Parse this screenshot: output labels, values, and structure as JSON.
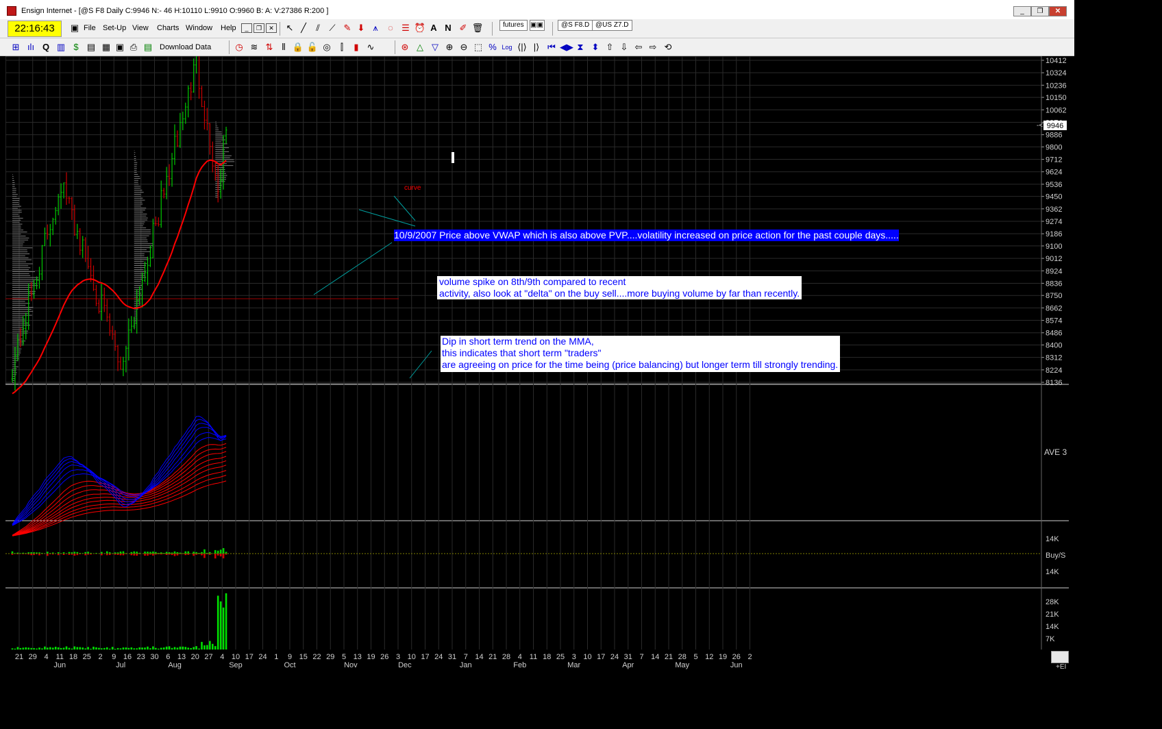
{
  "window": {
    "title": "Ensign Internet - [@S F8 Daily C:9946 N:- 46 H:10110 L:9910 O:9960 B: A: V:27386 R:200 ]",
    "clock": "22:16:43",
    "controls": {
      "minimize": "_",
      "restore": "❐",
      "close": "✕"
    }
  },
  "menu": [
    "File",
    "Set-Up",
    "View",
    "Charts",
    "Window",
    "Help"
  ],
  "tabs": {
    "futures": "futures",
    "chart1": "@S F8.D",
    "chart2": "@US Z7.D"
  },
  "toolbar": {
    "download_label": "Download Data"
  },
  "price_axis": {
    "ticks": [
      "10412",
      "10324",
      "10236",
      "10150",
      "10062",
      "9974",
      "9886",
      "9800",
      "9712",
      "9624",
      "9536",
      "9450",
      "9362",
      "9274",
      "9186",
      "9100",
      "9012",
      "8924",
      "8836",
      "8750",
      "8662",
      "8574",
      "8486",
      "8400",
      "8312",
      "8224",
      "8136"
    ],
    "current": "9946"
  },
  "mma_panel": {
    "label": "AVE 3"
  },
  "buysell_panel": {
    "ticks": [
      "14K",
      "Buy/S",
      "14K"
    ]
  },
  "volume_panel": {
    "ticks": [
      "28K",
      "21K",
      "14K",
      "7K"
    ]
  },
  "time_axis": {
    "days": [
      "21",
      "29",
      "4",
      "11",
      "18",
      "25",
      "2",
      "9",
      "16",
      "23",
      "30",
      "6",
      "13",
      "20",
      "27",
      "4",
      "10",
      "17",
      "24",
      "1",
      "9",
      "15",
      "22",
      "29",
      "5",
      "13",
      "19",
      "26",
      "3",
      "10",
      "17",
      "24",
      "31",
      "7",
      "14",
      "21",
      "28",
      "4",
      "11",
      "18",
      "25",
      "3",
      "10",
      "17",
      "24",
      "31",
      "7",
      "14",
      "21",
      "28",
      "5",
      "12",
      "19",
      "26",
      "2"
    ],
    "months": [
      "Jun",
      "Jul",
      "Aug",
      "Sep",
      "Oct",
      "Nov",
      "Dec",
      "Jan",
      "Feb",
      "Mar",
      "Apr",
      "May",
      "Jun"
    ],
    "corner": "+EI"
  },
  "annotations": {
    "curve_label": "curve",
    "note1": "10/9/2007 Price above VWAP which is also above PVP....volatility increased on price action for the past couple days.....",
    "note2_line1": "volume spike on 8th/9th compared to recent",
    "note2_line2": "activity, also look at \"delta\" on the buy sell....more buying volume by far than recently.",
    "note3_line1": "Dip in short term trend on the MMA,",
    "note3_line2": "this indicates that short term \"traders\"",
    "note3_line3": "are agreeing on price for the time being (price balancing) but longer term till strongly trending."
  },
  "colors": {
    "background": "#000000",
    "grid": "#2a2a2a",
    "up_bar": "#00c800",
    "down_bar": "#c80000",
    "vwap": "#ff0000",
    "mma_fast": "#0000ff",
    "mma_slow": "#ff0000",
    "note_text": "#0000ff",
    "trend_line": "#00a0a0",
    "volume": "#00e000",
    "clock_bg": "#ffff00"
  },
  "chart_data": {
    "type": "candlestick",
    "instrument": "@S F8 Daily",
    "ohlc_last": {
      "open": 9960,
      "high": 10110,
      "low": 9910,
      "close": 9946,
      "volume": 27386
    },
    "ylim": [
      8136,
      10412
    ],
    "key_points": [
      {
        "date": "2007-06-21",
        "close": 8250
      },
      {
        "date": "2007-07-16",
        "close": 9550
      },
      {
        "date": "2007-08-16",
        "close": 8250
      },
      {
        "date": "2007-09-24",
        "close": 10400
      },
      {
        "date": "2007-10-05",
        "close": 9480
      },
      {
        "date": "2007-10-09",
        "close": 9946
      }
    ]
  }
}
